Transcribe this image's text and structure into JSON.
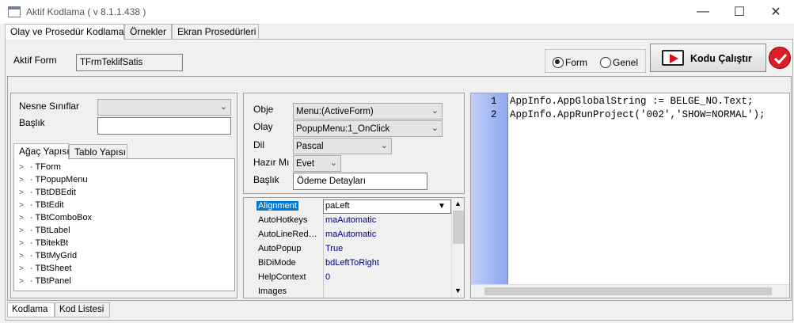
{
  "window": {
    "title": "Aktif Kodlama ( v 8.1.1.438 )",
    "minimize": "—",
    "maximize": "☐",
    "close": "✕"
  },
  "top_tabs": [
    "Olay ve Prosedür Kodlama",
    "Örnekler",
    "Ekran Prosedürleri"
  ],
  "header": {
    "aktif_form_label": "Aktif Form",
    "aktif_form_value": "TFrmTeklifSatis",
    "radio_form": "Form",
    "radio_genel": "Genel",
    "run_button": "Kodu Çalıştır",
    "selected_radio": "Form",
    "accent_color": "#d7141a"
  },
  "left_panel": {
    "nesne_label": "Nesne Sınıflar",
    "nesne_value": "",
    "baslik_label": "Başlık",
    "baslik_value": "",
    "tabs": [
      "Ağaç Yapısı",
      "Tablo Yapısı"
    ],
    "tree": [
      "TForm",
      "TPopupMenu",
      "TBtDBEdit",
      "TBtEdit",
      "TBtComboBox",
      "TBtLabel",
      "TBitekBt",
      "TBtMyGrid",
      "TBtSheet",
      "TBtPanel"
    ]
  },
  "middle_panel": {
    "obje_label": "Obje",
    "obje_value": "Menu:(ActiveForm)",
    "olay_label": "Olay",
    "olay_value": "PopupMenu:1_OnClick",
    "dil_label": "Dil",
    "dil_value": "Pascal",
    "hazir_label": "Hazır Mı",
    "hazir_value": "Evet",
    "baslik_label": "Başlık",
    "baslik_value": "Ödeme Detayları",
    "properties": [
      {
        "name": "Alignment",
        "value": "paLeft"
      },
      {
        "name": "AutoHotkeys",
        "value": "maAutomatic"
      },
      {
        "name": "AutoLineRed…",
        "value": "maAutomatic"
      },
      {
        "name": "AutoPopup",
        "value": "True"
      },
      {
        "name": "BiDiMode",
        "value": "bdLeftToRight"
      },
      {
        "name": "HelpContext",
        "value": "0"
      },
      {
        "name": "Images",
        "value": ""
      }
    ]
  },
  "editor": {
    "line_numbers": [
      "1",
      "2"
    ],
    "lines": [
      "AppInfo.AppGlobalString := BELGE_NO.Text;",
      "AppInfo.AppRunProject('002','SHOW=NORMAL');"
    ]
  },
  "bottom_tabs": [
    "Kodlama",
    "Kod Listesi"
  ]
}
